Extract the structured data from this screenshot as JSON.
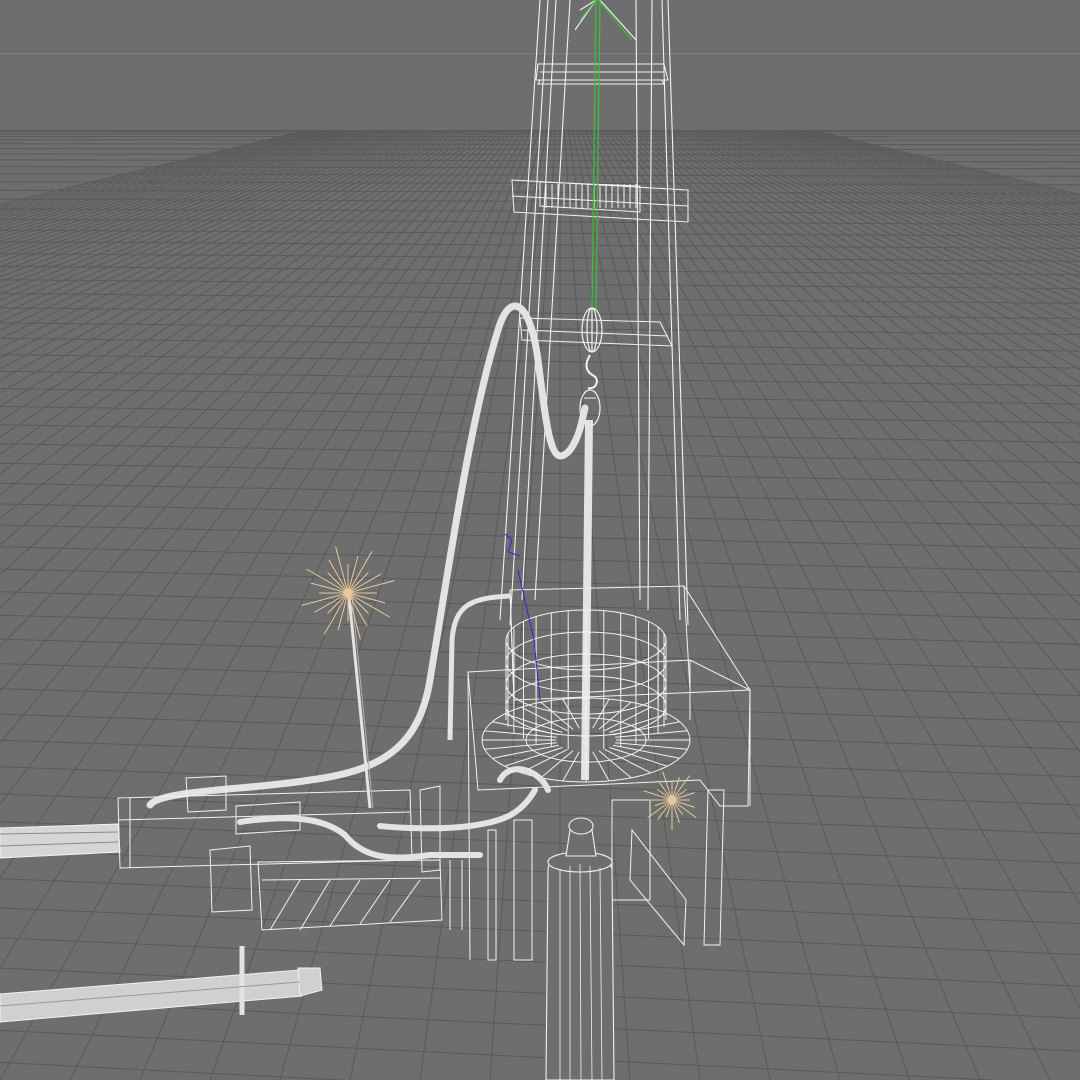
{
  "viewport": {
    "background_color": "#6e6e6e",
    "sky_color": "#6e6e6e",
    "grid_color": "#5a5a5a",
    "grid_major_color": "#505050",
    "horizon_line_color": "#7c95ad",
    "wireframe_color": "#f2f2f2",
    "tube_color": "#e3e3e3",
    "cable_color": "#3bbf3b",
    "selection_color": "#2a2ad0",
    "light_color": "#e8c89a"
  },
  "scene": {
    "objects": [
      "derrick-tower",
      "crown-platform",
      "monkey-board",
      "travelling-block",
      "hook",
      "kelly-hose",
      "mud-line",
      "rotary-table",
      "drill-floor",
      "drill-pipe",
      "pipe-rack",
      "catwalk",
      "spot-light-left",
      "spot-light-right"
    ]
  }
}
